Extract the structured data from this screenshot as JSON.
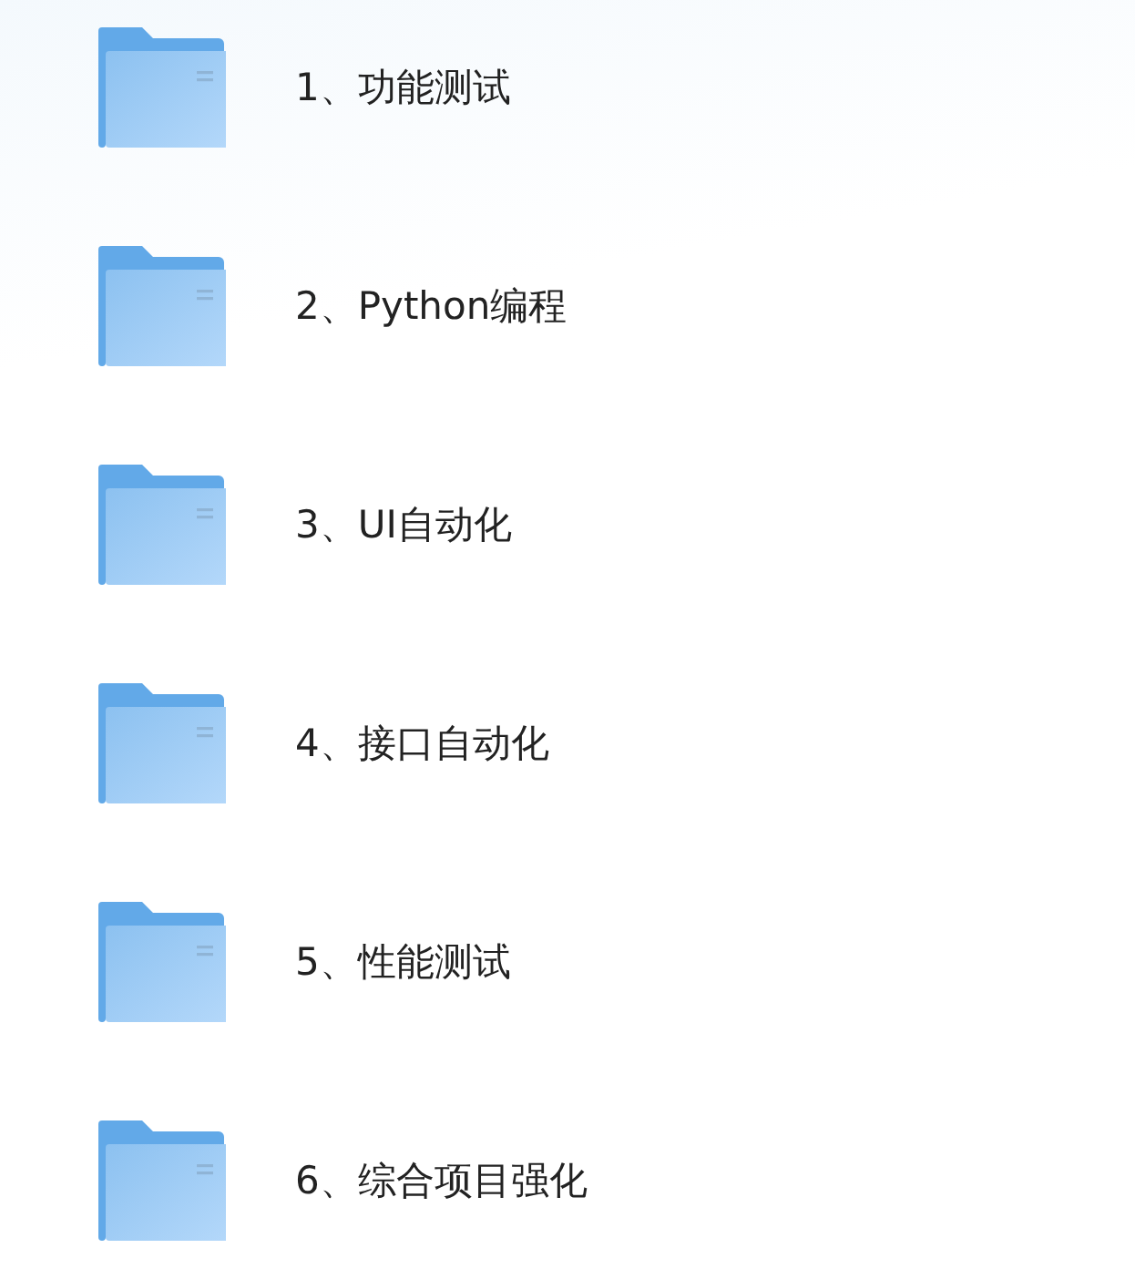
{
  "folders": [
    {
      "name": "1、功能测试"
    },
    {
      "name": "2、Python编程"
    },
    {
      "name": "3、UI自动化"
    },
    {
      "name": "4、接口自动化"
    },
    {
      "name": "5、性能测试"
    },
    {
      "name": "6、综合项目强化"
    }
  ]
}
